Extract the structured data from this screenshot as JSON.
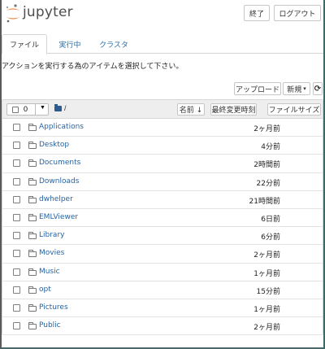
{
  "header": {
    "app_name": "jupyter",
    "quit_label": "終了",
    "logout_label": "ログアウト"
  },
  "tabs": [
    {
      "label": "ファイル",
      "active": true
    },
    {
      "label": "実行中",
      "active": false
    },
    {
      "label": "クラスタ",
      "active": false
    }
  ],
  "instruction": "アクションを実行する為のアイテムを選択して下さい。",
  "toolbar": {
    "upload_label": "アップロード",
    "new_label": "新規",
    "new_caret": "▾",
    "refresh_icon": "⟳"
  },
  "list_header": {
    "selected_count": "0",
    "breadcrumb": "/",
    "sort_name_label": "名前 ↓",
    "sort_modified_label": "最終変更時刻",
    "sort_size_label": "ファイルサイズ"
  },
  "files": [
    {
      "name": "Applications",
      "modified": "2ヶ月前"
    },
    {
      "name": "Desktop",
      "modified": "4分前"
    },
    {
      "name": "Documents",
      "modified": "2時間前"
    },
    {
      "name": "Downloads",
      "modified": "22分前"
    },
    {
      "name": "dwhelper",
      "modified": "21時間前"
    },
    {
      "name": "EMLViewer",
      "modified": "6日前"
    },
    {
      "name": "Library",
      "modified": "6分前"
    },
    {
      "name": "Movies",
      "modified": "2ヶ月前"
    },
    {
      "name": "Music",
      "modified": "1ヶ月前"
    },
    {
      "name": "opt",
      "modified": "15分前"
    },
    {
      "name": "Pictures",
      "modified": "1ヶ月前"
    },
    {
      "name": "Public",
      "modified": "2ヶ月前"
    }
  ],
  "colors": {
    "link": "#2563a6",
    "logo_orange": "#f37726",
    "folder_header": "#2c5c8f"
  }
}
